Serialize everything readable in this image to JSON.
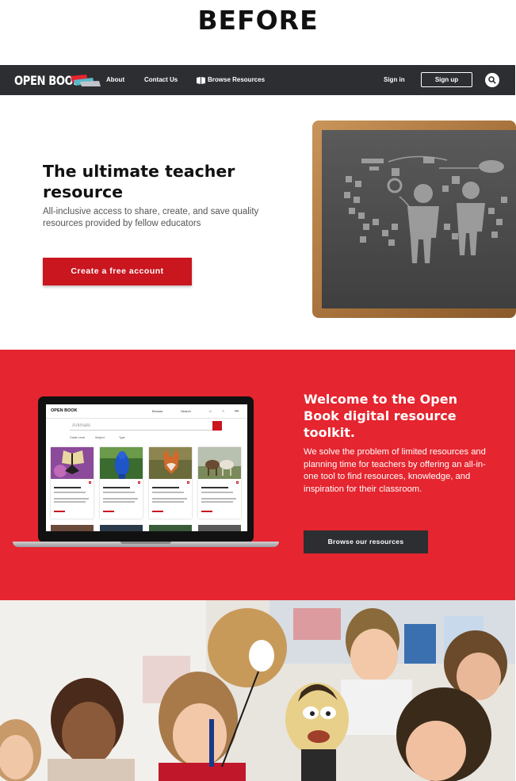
{
  "label": "BEFORE",
  "colors": {
    "dark": "#2d2e32",
    "red": "#e5252f",
    "cta_red": "#c9161f",
    "white": "#ffffff"
  },
  "nav": {
    "logo": "OPEN BOOK",
    "about": "About",
    "contact": "Contact Us",
    "browse": "Browse Resources",
    "browse_icon": "open-book-icon",
    "signin": "Sign in",
    "signup": "Sign up",
    "search_icon": "search-icon"
  },
  "hero": {
    "title": "The ultimate teacher resource",
    "subtitle": "All-inclusive access to share, create, and save quality resources provided by fellow educators",
    "cta": "Create a free account"
  },
  "welcome": {
    "title": "Welcome to the Open Book digital resource toolkit.",
    "body": "We solve the problem of limited resources and planning time for teachers by offering an all-in-one tool to find resources, knowledge, and inspiration for their classroom.",
    "button": "Browse our resources"
  },
  "laptop": {
    "logo": "OPEN BOOK",
    "browse": "Browse",
    "search": "Search",
    "search_value": "Animals",
    "filters": [
      "Grade Level",
      "Subject",
      "Type"
    ]
  }
}
